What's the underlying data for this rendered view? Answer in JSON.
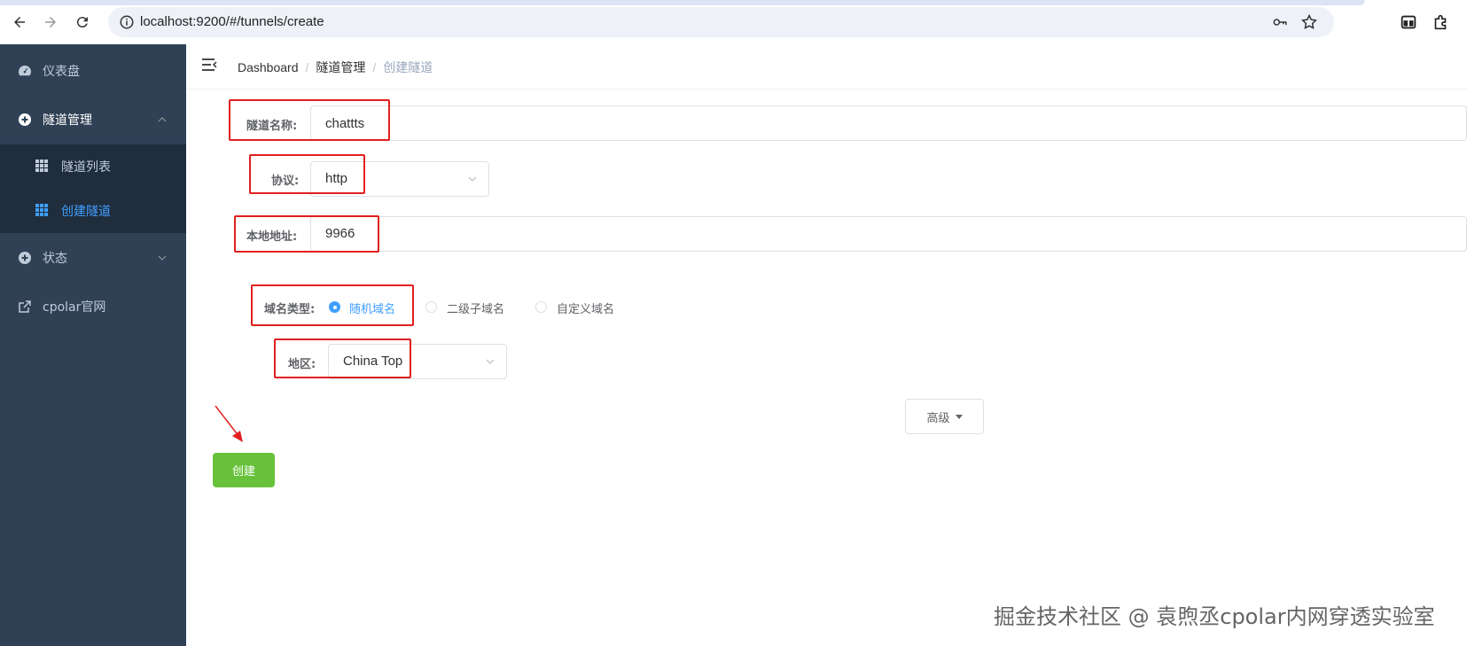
{
  "browser": {
    "url": "localhost:9200/#/tunnels/create"
  },
  "sidebar": {
    "items": [
      {
        "label": "仪表盘",
        "icon": "dashboard-icon"
      },
      {
        "label": "隧道管理",
        "icon": "plus-circle-icon"
      },
      {
        "label": "状态",
        "icon": "plus-circle-icon"
      },
      {
        "label": "cpolar官网",
        "icon": "external-link-icon"
      }
    ],
    "submenu": [
      {
        "label": "隧道列表",
        "icon": "grid-icon"
      },
      {
        "label": "创建隧道",
        "icon": "grid-icon",
        "active": true
      }
    ]
  },
  "breadcrumb": {
    "items": [
      "Dashboard",
      "隧道管理",
      "创建隧道"
    ],
    "separator": "/"
  },
  "form": {
    "name_label": "隧道名称:",
    "name_value": "chattts",
    "protocol_label": "协议:",
    "protocol_value": "http",
    "local_label": "本地地址:",
    "local_value": "9966",
    "domain_label": "域名类型:",
    "domain_options": [
      "随机域名",
      "二级子域名",
      "自定义域名"
    ],
    "domain_selected": "随机域名",
    "region_label": "地区:",
    "region_value": "China Top"
  },
  "buttons": {
    "advanced": "高级",
    "create": "创建"
  },
  "watermark": "掘金技术社区 @ 袁煦丞cpolar内网穿透实验室",
  "colors": {
    "sidebar_bg": "#304156",
    "submenu_bg": "#1f2d3d",
    "active": "#409eff",
    "create_btn": "#67c23a",
    "highlight": "#e02020"
  }
}
